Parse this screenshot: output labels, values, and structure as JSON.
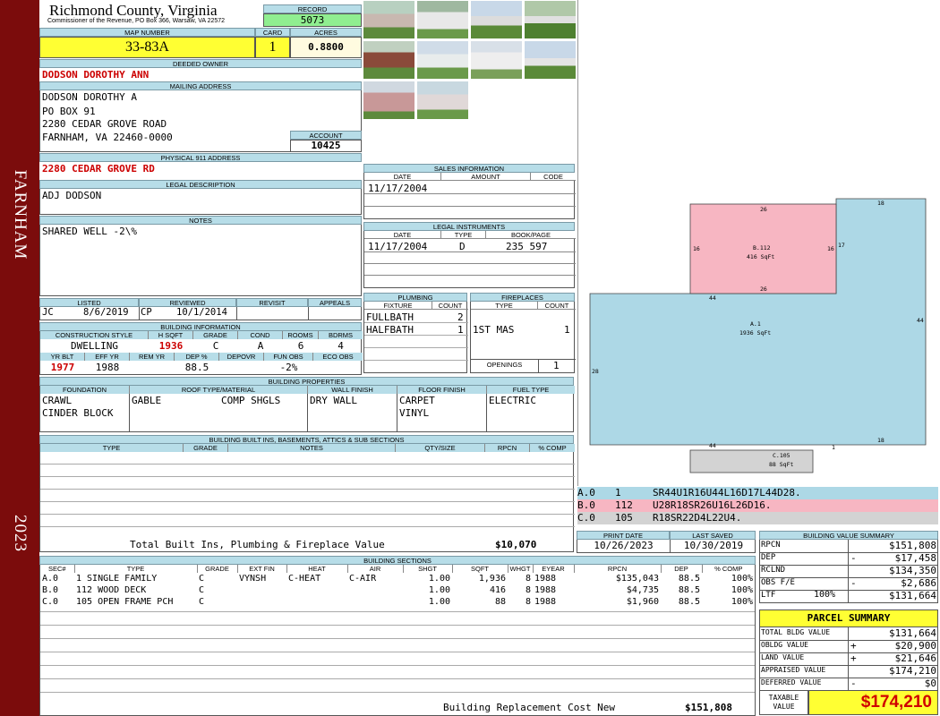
{
  "sidebar": {
    "city": "FARNHAM",
    "year": "2023"
  },
  "header": {
    "county": "Richmond County, Virginia",
    "commissioner": "Commissioner of the Revenue, PO Box 366, Warsaw, VA 22572"
  },
  "record": {
    "label": "RECORD",
    "value": "5073"
  },
  "map": {
    "label": "MAP NUMBER",
    "value": "33-83A"
  },
  "card": {
    "label": "CARD",
    "value": "1"
  },
  "acres": {
    "label": "ACRES",
    "value": "0.8800"
  },
  "owner": {
    "label": "DEEDED OWNER",
    "value": "DODSON DOROTHY ANN"
  },
  "mailing": {
    "label": "MAILING ADDRESS",
    "lines": [
      "DODSON DOROTHY A",
      "PO BOX 91",
      "2280 CEDAR GROVE ROAD",
      "FARNHAM, VA 22460-0000"
    ]
  },
  "account": {
    "label": "ACCOUNT",
    "value": "10425"
  },
  "physical": {
    "label": "PHYSICAL 911 ADDRESS",
    "value": "2280 CEDAR GROVE RD"
  },
  "legal": {
    "label": "LEGAL DESCRIPTION",
    "value": "ADJ DODSON"
  },
  "notes": {
    "label": "NOTES",
    "value": "SHARED WELL -2\\%"
  },
  "review": {
    "headers": [
      "LISTED",
      "REVIEWED",
      "REVISIT",
      "APPEALS"
    ],
    "listed_by": "JC",
    "listed_date": "8/6/2019",
    "reviewed_by": "CP",
    "reviewed_date": "10/1/2014"
  },
  "building_info": {
    "label": "BUILDING INFORMATION",
    "headers": [
      "CONSTRUCTION STYLE",
      "H SQFT",
      "GRADE",
      "COND",
      "ROOMS",
      "BDRMS"
    ],
    "values": [
      "DWELLING",
      "1936",
      "C",
      "A",
      "6",
      "4"
    ],
    "headers2": [
      "YR BLT",
      "EFF YR",
      "REM YR",
      "DEP %",
      "DEPOVR",
      "FUN OBS",
      "ECO OBS"
    ],
    "values2": [
      "1977",
      "1988",
      "",
      "88.5",
      "",
      "-2%",
      ""
    ]
  },
  "properties": {
    "label": "BUILDING PROPERTIES",
    "headers": [
      "FOUNDATION",
      "ROOF TYPE/MATERIAL",
      "WALL FINISH",
      "FLOOR FINISH",
      "FUEL TYPE"
    ],
    "foundation": [
      "CRAWL",
      "CINDER BLOCK"
    ],
    "roof_type": "GABLE",
    "roof_material": "COMP SHGLS",
    "wall": "DRY WALL",
    "floor": [
      "CARPET",
      "VINYL"
    ],
    "fuel": "ELECTRIC"
  },
  "builtins": {
    "label": "BUILDING BUILT INS, BASEMENTS, ATTICS & SUB SECTIONS",
    "headers": [
      "TYPE",
      "GRADE",
      "NOTES",
      "QTY/SIZE",
      "RPCN",
      "% COMP"
    ],
    "total_label": "Total Built Ins, Plumbing & Fireplace Value",
    "total_value": "$10,070"
  },
  "sales": {
    "label": "SALES INFORMATION",
    "headers": [
      "DATE",
      "AMOUNT",
      "CODE"
    ],
    "rows": [
      [
        "11/17/2004",
        "",
        ""
      ]
    ]
  },
  "instruments": {
    "label": "LEGAL INSTRUMENTS",
    "headers": [
      "DATE",
      "TYPE",
      "BOOK/PAGE"
    ],
    "rows": [
      [
        "11/17/2004",
        "D",
        "235 597"
      ]
    ]
  },
  "plumbing": {
    "label": "PLUMBING",
    "headers": [
      "FIXTURE",
      "COUNT"
    ],
    "rows": [
      [
        "FULLBATH",
        "2"
      ],
      [
        "HALFBATH",
        "1"
      ]
    ]
  },
  "fireplaces": {
    "label": "FIREPLACES",
    "headers": [
      "TYPE",
      "COUNT"
    ],
    "rows": [
      [
        "1ST MAS",
        "1"
      ]
    ],
    "openings_label": "OPENINGS",
    "openings": "1"
  },
  "sketch": {
    "shapes": [
      {
        "name": "B.112",
        "area": "416 SqFt",
        "color": "#f7b6c2"
      },
      {
        "name": "A.1",
        "area": "1936 SqFt",
        "color": "#add8e6"
      },
      {
        "name": "C.105",
        "area": "88 SqFt",
        "color": "#d3d3d3"
      }
    ],
    "dims": {
      "b_top": "26",
      "b_left": "16",
      "b_right": "16",
      "b_bottom": "26",
      "a_top_right": "18",
      "a_step": "17",
      "a_inner": "44",
      "a_left": "28",
      "a_right": "44",
      "a_bottom": "44",
      "a_bottom_right": "18",
      "a_notch": "1"
    },
    "legend": [
      {
        "code": "A.0",
        "num": "1",
        "path": "SR44U1R16U44L16D17L44D28.",
        "color": "#add8e6"
      },
      {
        "code": "B.0",
        "num": "112",
        "path": "U28R18SR26U16L26D16.",
        "color": "#f7b6c2"
      },
      {
        "code": "C.0",
        "num": "105",
        "path": "R18SR22D4L22U4.",
        "color": "#d3d3d3"
      }
    ]
  },
  "dates": {
    "print_label": "PRINT DATE",
    "print": "10/26/2023",
    "saved_label": "LAST SAVED",
    "saved": "10/30/2019"
  },
  "sections": {
    "label": "BUILDING SECTIONS",
    "headers": [
      "SEC#",
      "TYPE",
      "GRADE",
      "EXT FIN",
      "HEAT",
      "AIR",
      "SHGT",
      "SQFT",
      "WHGT",
      "EYEAR",
      "RPCN",
      "DEP",
      "% COMP"
    ],
    "rows": [
      [
        "A.0",
        "1 SINGLE FAMILY",
        "C",
        "VYNSH",
        "C-HEAT",
        "C-AIR",
        "1.00",
        "1,936",
        "8",
        "1988",
        "$135,043",
        "88.5",
        "100%"
      ],
      [
        "B.0",
        "112 WOOD DECK",
        "C",
        "",
        "",
        "",
        "1.00",
        "416",
        "8",
        "1988",
        "$4,735",
        "88.5",
        "100%"
      ],
      [
        "C.0",
        "105 OPEN FRAME PCH",
        "C",
        "",
        "",
        "",
        "1.00",
        "88",
        "8",
        "1988",
        "$1,960",
        "88.5",
        "100%"
      ]
    ],
    "footer_label": "Building Replacement Cost New",
    "footer_value": "$151,808"
  },
  "value_summary": {
    "label": "BUILDING VALUE SUMMARY",
    "rows": [
      {
        "label": "RPCN",
        "sign": "",
        "value": "$151,808"
      },
      {
        "label": "DEP",
        "sign": "-",
        "value": "$17,458"
      },
      {
        "label": "RCLND",
        "sign": "",
        "value": "$134,350"
      },
      {
        "label": "OBS F/E",
        "sign": "-",
        "value": "$2,686"
      },
      {
        "label": "LTF",
        "pct": "100%",
        "sign": "",
        "value": "$131,664"
      }
    ]
  },
  "parcel": {
    "label": "PARCEL SUMMARY",
    "rows": [
      {
        "label": "TOTAL BLDG VALUE",
        "sign": "",
        "value": "$131,664"
      },
      {
        "label": "OBLDG VALUE",
        "sign": "+",
        "value": "$20,900"
      },
      {
        "label": "LAND VALUE",
        "sign": "+",
        "value": "$21,646"
      },
      {
        "label": "APPRAISED VALUE",
        "sign": "",
        "value": "$174,210"
      },
      {
        "label": "DEFERRED VALUE",
        "sign": "-",
        "value": "$0"
      }
    ],
    "taxable_label": "TAXABLE VALUE",
    "taxable_value": "$174,210"
  }
}
